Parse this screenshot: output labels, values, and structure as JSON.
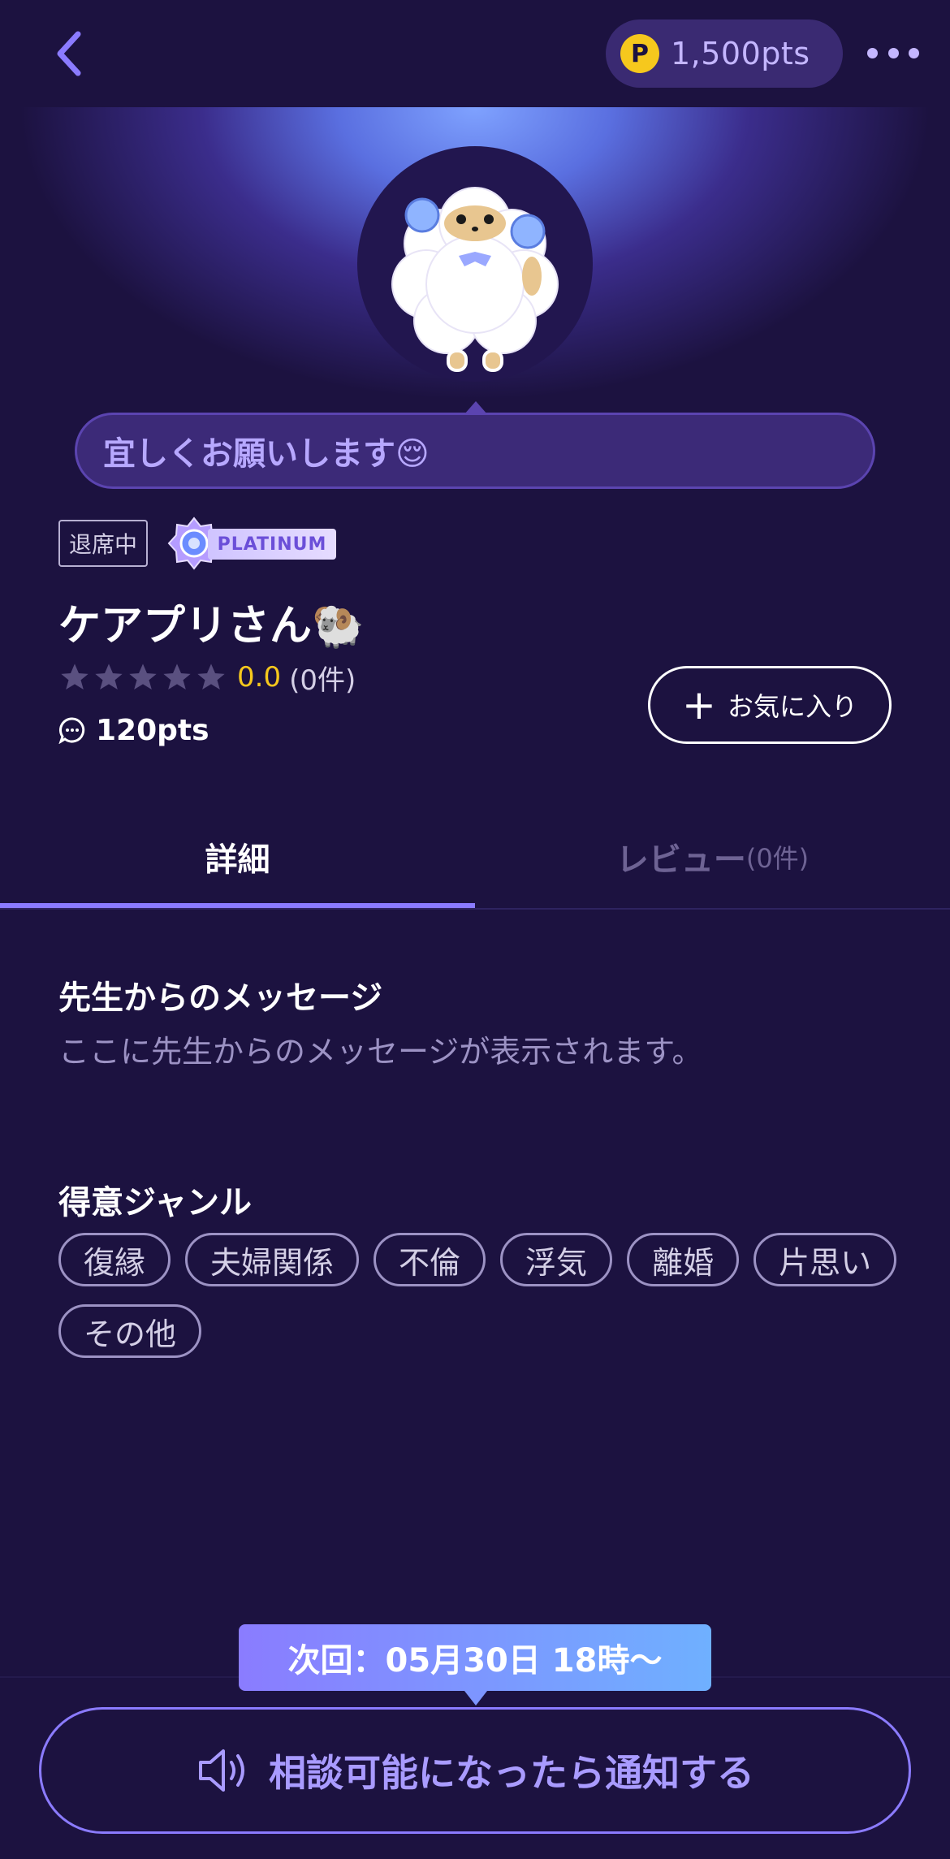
{
  "header": {
    "points": "1,500pts",
    "coin_symbol": "P"
  },
  "profile": {
    "greeting": "宜しくお願いします😌",
    "status": "退席中",
    "rank": "PLATINUM",
    "name": "ケアプリさん🐏",
    "rating": {
      "stars_filled": 0,
      "stars_total": 5,
      "value": "0.0",
      "count": "(0件)"
    },
    "price": "120pts",
    "favorite_label": "お気に入り"
  },
  "tabs": {
    "details": "詳細",
    "reviews": "レビュー",
    "reviews_count": "(0件)",
    "active": "details"
  },
  "message": {
    "title": "先生からのメッセージ",
    "body": "ここに先生からのメッセージが表示されます。"
  },
  "genres": {
    "title": "得意ジャンル",
    "items": [
      "復縁",
      "夫婦関係",
      "不倫",
      "浮気",
      "離婚",
      "片思い",
      "その他"
    ]
  },
  "footer": {
    "next_time": "次回：05月30日 18時〜",
    "notify_label": "相談可能になったら通知する"
  },
  "colors": {
    "background": "#1c1240",
    "accent": "#8b7bff",
    "coin": "#f6c81d",
    "rating": "#f6c81d"
  }
}
